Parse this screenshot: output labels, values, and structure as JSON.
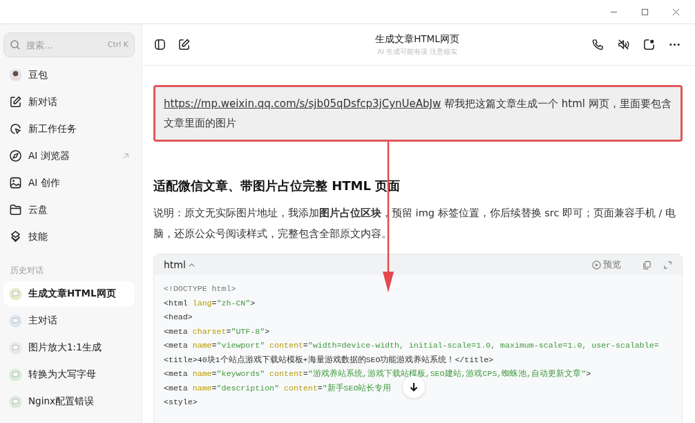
{
  "sidebar": {
    "search": {
      "placeholder": "搜索...",
      "shortcut": "Ctrl K"
    },
    "items": [
      {
        "kind": "avatar",
        "label": "豆包"
      },
      {
        "kind": "pencil",
        "label": "新对话"
      },
      {
        "kind": "pointer",
        "label": "新工作任务"
      },
      {
        "kind": "compass",
        "label": "AI 浏览器",
        "external": true
      },
      {
        "kind": "image",
        "label": "AI 创作"
      },
      {
        "kind": "folder",
        "label": "云盘"
      },
      {
        "kind": "layers",
        "label": "技能"
      }
    ],
    "history_title": "历史对话",
    "history": [
      {
        "label": "生成文章HTML网页",
        "selected": true,
        "color": "#e6ebc8"
      },
      {
        "label": "主对话",
        "selected": false,
        "color": "#dce6f2"
      },
      {
        "label": "图片放大1:1生成",
        "selected": false,
        "color": "#e8e8ec"
      },
      {
        "label": "转换为大写字母",
        "selected": false,
        "color": "#d9ead9"
      },
      {
        "label": "Nginx配置错误",
        "selected": false,
        "color": "#dcebdc"
      }
    ]
  },
  "header": {
    "title": "生成文章HTML网页",
    "subtitle": "AI 生成可能有误 注意核实"
  },
  "user_message": {
    "link": "https://mp.weixin.qq.com/s/sjb05qDsfcp3jCynUeAbJw",
    "text": " 帮我把这篇文章生成一个 html 网页，里面要包含文章里面的图片",
    "highlighted": true
  },
  "answer": {
    "heading": "适配微信文章、带图片占位完整 HTML 页面",
    "paragraph": "说明：原文无实际图片地址，我添加**图片占位区块**，预留 img 标签位置，你后续替换 src 即可；页面兼容手机 / 电脑，还原公众号阅读样式，完整包含全部原文内容。"
  },
  "code_block": {
    "language": "html",
    "preview": "预览",
    "lines": [
      [
        {
          "kind": "doctype",
          "text": "<!DOCTYPE html>"
        }
      ],
      [
        {
          "kind": "tag",
          "text": "<html "
        },
        {
          "kind": "attr",
          "text": "lang"
        },
        {
          "kind": "tag",
          "text": "="
        },
        {
          "kind": "str",
          "text": "\"zh-CN\""
        },
        {
          "kind": "tag",
          "text": ">"
        }
      ],
      [
        {
          "kind": "tag",
          "text": "<head>"
        }
      ],
      [
        {
          "kind": "tag",
          "text": "<meta "
        },
        {
          "kind": "attr",
          "text": "charset"
        },
        {
          "kind": "tag",
          "text": "="
        },
        {
          "kind": "str",
          "text": "\"UTF-8\""
        },
        {
          "kind": "tag",
          "text": ">"
        }
      ],
      [
        {
          "kind": "tag",
          "text": "<meta "
        },
        {
          "kind": "attr",
          "text": "name"
        },
        {
          "kind": "tag",
          "text": "="
        },
        {
          "kind": "str",
          "text": "\"viewport\" "
        },
        {
          "kind": "attr",
          "text": "content"
        },
        {
          "kind": "tag",
          "text": "="
        },
        {
          "kind": "str",
          "text": "\"width=device-width, initial-scale=1.0, maximum-scale=1.0, user-scalable="
        }
      ],
      [
        {
          "kind": "tag",
          "text": "<title>40块1个站点游戏下载站模板+海量游戏数据的SEO功能游戏养站系统！</title>"
        }
      ],
      [
        {
          "kind": "tag",
          "text": "<meta "
        },
        {
          "kind": "attr",
          "text": "name"
        },
        {
          "kind": "tag",
          "text": "="
        },
        {
          "kind": "str",
          "text": "\"keywords\" "
        },
        {
          "kind": "attr",
          "text": "content"
        },
        {
          "kind": "tag",
          "text": "="
        },
        {
          "kind": "str",
          "text": "\"游戏养站系统,游戏下载站模板,SEO建站,游戏CPS,蜘蛛池,自动更新文章\""
        },
        {
          "kind": "tag",
          "text": ">"
        }
      ],
      [
        {
          "kind": "tag",
          "text": "<meta "
        },
        {
          "kind": "attr",
          "text": "name"
        },
        {
          "kind": "tag",
          "text": "="
        },
        {
          "kind": "str",
          "text": "\"description\" "
        },
        {
          "kind": "attr",
          "text": "content"
        },
        {
          "kind": "tag",
          "text": "="
        },
        {
          "kind": "str",
          "text": "\"新手SEO站长专用"
        }
      ],
      [
        {
          "kind": "tag",
          "text": "<style>"
        }
      ]
    ]
  }
}
